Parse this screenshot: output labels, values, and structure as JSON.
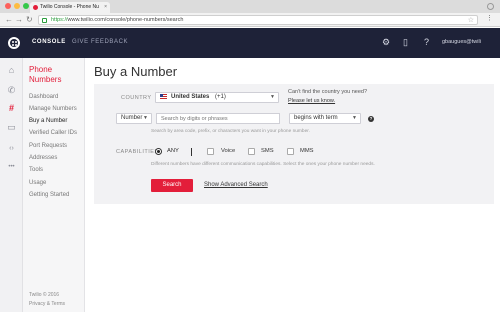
{
  "browser": {
    "tab_title": "Twilio Console - Phone Nu",
    "tab_close": "×",
    "url_scheme": "https://",
    "url_rest": "www.twilio.com/console/phone-numbers/search",
    "back_icon": "←",
    "forward_icon": "→",
    "reload_icon": "↻",
    "star_icon": "☆",
    "menu_icon": "⋮"
  },
  "topnav": {
    "console": "CONSOLE",
    "feedback": "GIVE FEEDBACK",
    "user": "gbaugues@twili",
    "icons": {
      "debugger": "⚙",
      "docs": "▯",
      "help": "?",
      "apps": "⋮"
    }
  },
  "rail": {
    "icons": [
      {
        "name": "home-icon",
        "glyph": "⌂"
      },
      {
        "name": "phone-icon",
        "glyph": "✆"
      },
      {
        "name": "phone-numbers-icon",
        "glyph": "#"
      },
      {
        "name": "chat-icon",
        "glyph": "▭"
      },
      {
        "name": "code-icon",
        "glyph": "‹›"
      },
      {
        "name": "more-icon",
        "glyph": "•••"
      }
    ]
  },
  "sidebar": {
    "title": "Phone Numbers",
    "items": [
      "Dashboard",
      "Manage Numbers",
      "Buy a Number",
      "Verified Caller IDs",
      "Port Requests",
      "Addresses",
      "Tools",
      "Usage",
      "Getting Started"
    ],
    "footer": [
      "Twilio © 2016",
      "Privacy & Terms"
    ]
  },
  "main": {
    "title": "Buy a Number",
    "country_label": "COUNTRY",
    "country_name": "United States",
    "country_code": "(+1)",
    "cant_find": "Can't find the country you need?",
    "let_us_know": "Please let us know.",
    "search_type": "Number",
    "search_placeholder": "Search by digits or phrases",
    "match_type": "begins with term",
    "search_hint": "Search by area code, prefix, or characters you want in your phone number.",
    "capabilities_label": "CAPABILITIES",
    "cap_any": "ANY",
    "cap_voice": "Voice",
    "cap_sms": "SMS",
    "cap_mms": "MMS",
    "cap_hint": "Different numbers have different communications capabilities. Select the ones your phone number needs.",
    "search_button": "Search",
    "advanced_link": "Show Advanced Search"
  },
  "colors": {
    "accent": "#e31e3a",
    "nav_bg": "#1e2238"
  }
}
